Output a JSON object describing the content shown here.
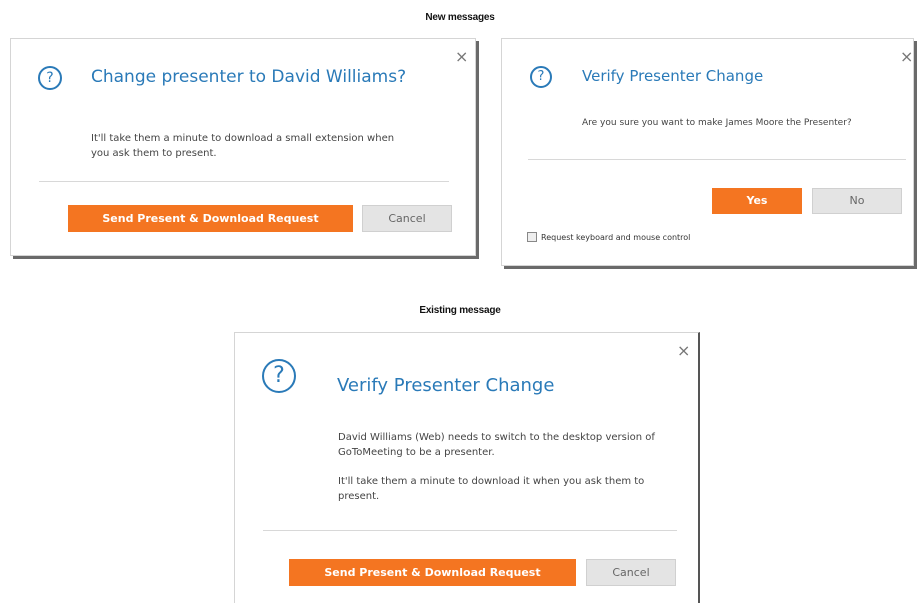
{
  "sections": {
    "new_messages": "New messages",
    "existing_message": "Existing message"
  },
  "dialog1": {
    "close_glyph": "×",
    "help_glyph": "?",
    "title": "Change presenter to David Williams?",
    "body": "It'll take them a minute to download a small extension when you ask them to present.",
    "primary_label": "Send Present & Download Request",
    "cancel_label": "Cancel"
  },
  "dialog2": {
    "close_glyph": "×",
    "help_glyph": "?",
    "title": "Verify Presenter Change",
    "body": "Are you sure you want to make James Moore the Presenter?",
    "yes_label": "Yes",
    "no_label": "No",
    "checkbox_label": "Request keyboard and mouse control"
  },
  "dialog3": {
    "close_glyph": "×",
    "help_glyph": "?",
    "title": "Verify Presenter Change",
    "body_1": "David Williams (Web) needs to switch to the desktop version of GoToMeeting to be a presenter.",
    "body_2": "It'll take them a minute to download it when you ask them to present.",
    "primary_label": "Send Present & Download Request",
    "cancel_label": "Cancel"
  },
  "colors": {
    "accent_blue": "#2a7ab8",
    "primary_orange": "#f47521",
    "secondary_gray": "#e4e4e4"
  }
}
